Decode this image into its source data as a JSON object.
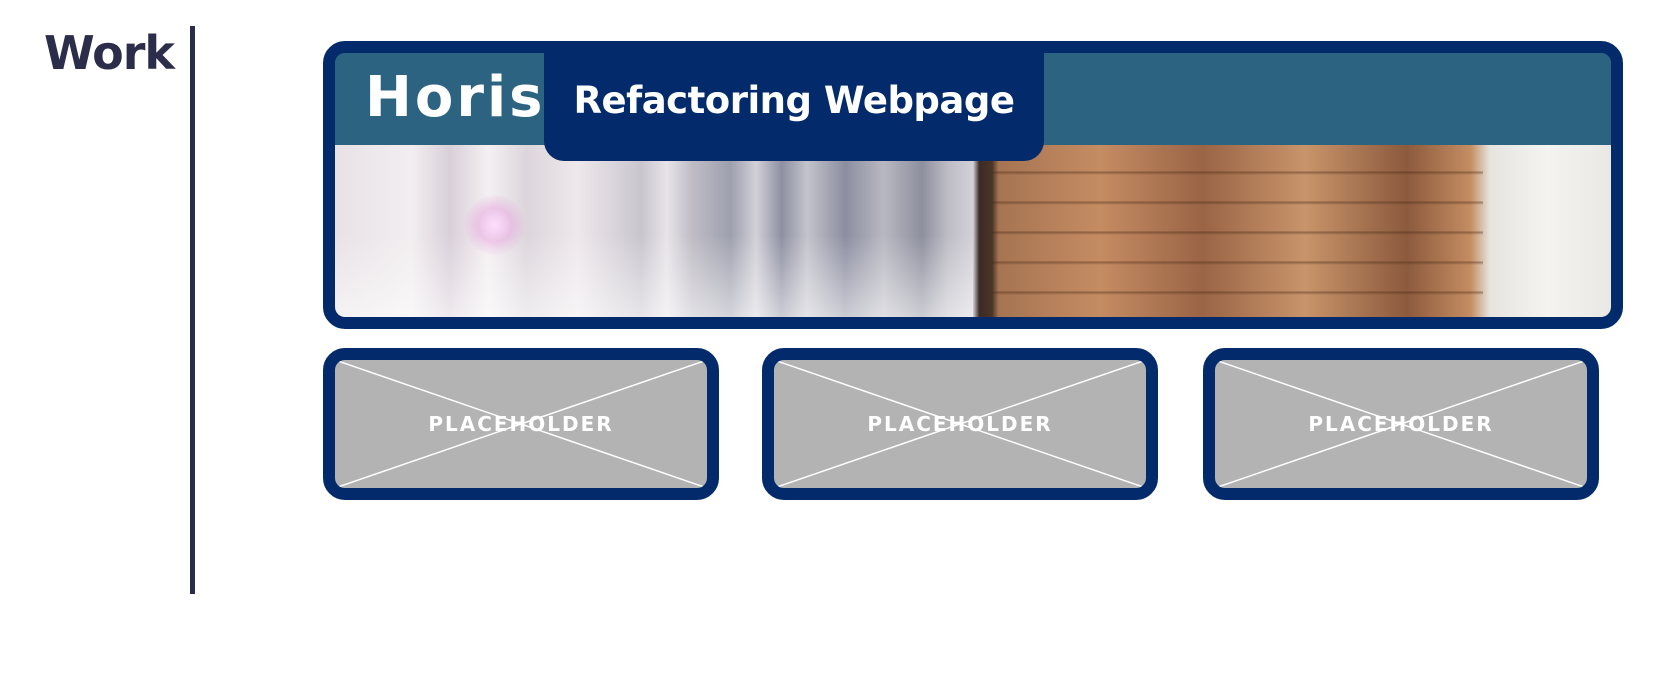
{
  "section": {
    "title": "Work"
  },
  "featured": {
    "banner_text": "Horis",
    "title": "Refactoring Webpage"
  },
  "cards": [
    {
      "label": "PLACEHOLDER"
    },
    {
      "label": "PLACEHOLDER"
    },
    {
      "label": "PLACEHOLDER"
    }
  ],
  "colors": {
    "border": "#032b6c",
    "heading": "#2b2d4a",
    "banner": "#2c6381",
    "placeholder_bg": "#b3b3b3"
  }
}
